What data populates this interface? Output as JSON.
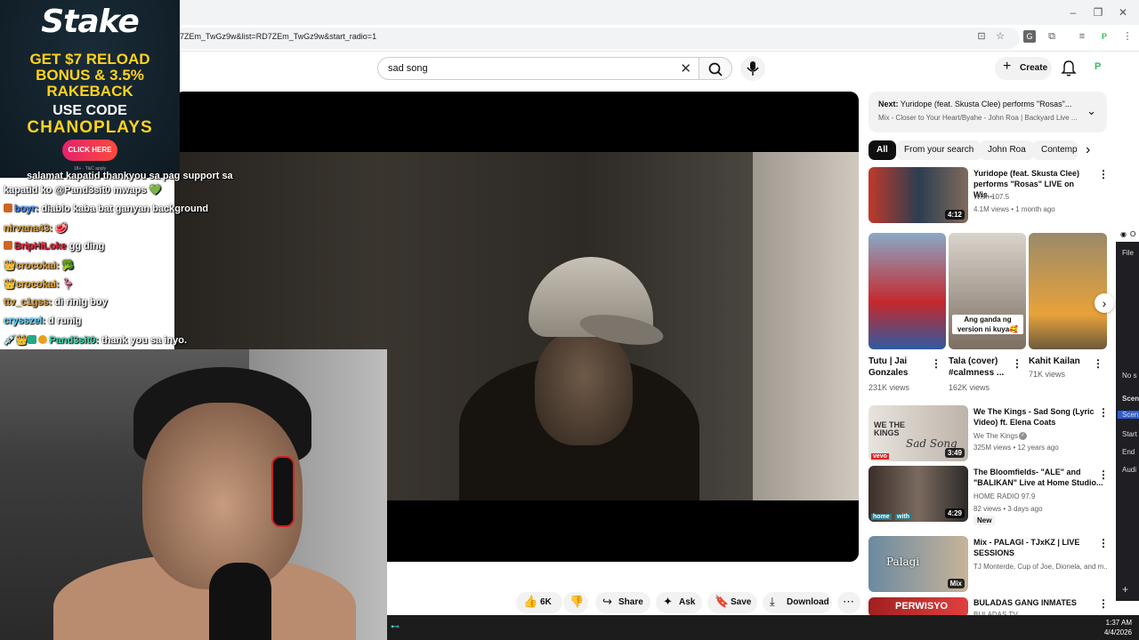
{
  "browser": {
    "url": "7ZEm_TwGz9w&list=RD7ZEm_TwGz9w&start_radio=1",
    "window_controls": [
      "minimize-icon",
      "restore-icon",
      "close-icon"
    ]
  },
  "youtube": {
    "search": {
      "value": "sad song"
    },
    "create_label": "Create",
    "next_up": {
      "label": "Next:",
      "title": "Yuridope (feat. Skusta Clee) performs \"Rosas\"...",
      "subtitle": "Mix - Closer to Your Heart/Byahe - John Roa | Backyard Live ..."
    },
    "chips": [
      "All",
      "From your search",
      "John Roa",
      "Contemp"
    ],
    "actions": {
      "likes": "6K",
      "share": "Share",
      "ask": "Ask",
      "save": "Save",
      "download": "Download"
    },
    "recs": [
      {
        "title": "Yuridope (feat. Skusta Clee) performs \"Rosas\" LIVE on Wis...",
        "channel": "Wish 107.5",
        "meta": "4.1M views • 1 month ago",
        "duration": "4:12"
      },
      {
        "title": "We The Kings - Sad Song (Lyric Video) ft. Elena Coats",
        "channel": "We The Kings",
        "meta": "325M views • 12 years ago",
        "duration": "3:49"
      },
      {
        "title": "The Bloomfields- \"ALE\" and \"BALIKAN\" Live at Home Studio...",
        "channel": "HOME RADIO 97.9",
        "meta": "82 views • 3 days ago",
        "duration": "4:29",
        "badge": "New"
      },
      {
        "title": "Mix - PALAGI - TJxKZ | LIVE SESSIONS",
        "channel": "TJ Monterde, Cup of Joe, Dionela, and m...",
        "meta": "",
        "duration": "Mix"
      },
      {
        "title": "BULADAS GANG INMATES",
        "channel": "BULADAS TV",
        "meta": "",
        "duration": ""
      }
    ],
    "shorts": [
      {
        "title": "Tutu | Jai Gonzales",
        "views": "231K views",
        "overlay": ""
      },
      {
        "title": "Tala (cover) #calmness ...",
        "views": "162K views",
        "overlay": "Ang ganda ng version ni kuya🥰"
      },
      {
        "title": "Kahit Kailan",
        "views": "71K views",
        "overlay": ""
      }
    ],
    "thumb_texts": {
      "wtk_logo": "WE THE KINGS",
      "wtk_script": "Sad Song",
      "vevo": "vevo",
      "palagi": "Palagi",
      "home": "home",
      "with": "with",
      "perwisyo": "PERWISYO"
    }
  },
  "ad": {
    "brand": "Stake",
    "line1": "GET $7 RELOAD",
    "line2": "BONUS & 3.5%",
    "line3": "RAKEBACK",
    "code_label": "USE CODE",
    "code": "CHANOPLAYS",
    "button": "CLICK HERE",
    "terms": "18+ · T&C apply"
  },
  "chat": [
    {
      "user": "",
      "message": "salamat kapatid thankyou sa pag support sa",
      "color": "#ffffff"
    },
    {
      "user": "",
      "message": "kapatid ko @Pand3sit0 mwaps",
      "color": "#ffffff",
      "heart": true
    },
    {
      "user": "boyr:",
      "message": "diablo kaba bat ganyan background",
      "color": "#3d8cff"
    },
    {
      "user": "nirvana43:",
      "message": "",
      "color": "#d9a441"
    },
    {
      "user": "BripHiLoke",
      "message": "gg ding",
      "color": "#e0233a"
    },
    {
      "user": "crocokai:",
      "message": "",
      "color": "#e6a733"
    },
    {
      "user": "crocokai:",
      "message": "",
      "color": "#e6a733"
    },
    {
      "user": "ttv_c1gss:",
      "message": "di rinig boy",
      "color": "#d9a441"
    },
    {
      "user": "crysszel:",
      "message": "d runig",
      "color": "#5ad5ff"
    },
    {
      "user": "Pand3sit0:",
      "message": "thank you sa inyo.",
      "color": "#3dd6b0"
    }
  ],
  "obs_panel": {
    "title": "O",
    "menu": "File",
    "labels": [
      "No s",
      "Scen",
      "Scen",
      "Start",
      "End",
      "Audi"
    ]
  },
  "taskbar": {
    "time": "1:37 AM",
    "date": "4/4/2026"
  },
  "colors": {
    "yt_red": "#ff0000",
    "chip_active": "#0f0f0f",
    "ad_yellow": "#ffd21e",
    "ad_button": "#e3226c"
  }
}
